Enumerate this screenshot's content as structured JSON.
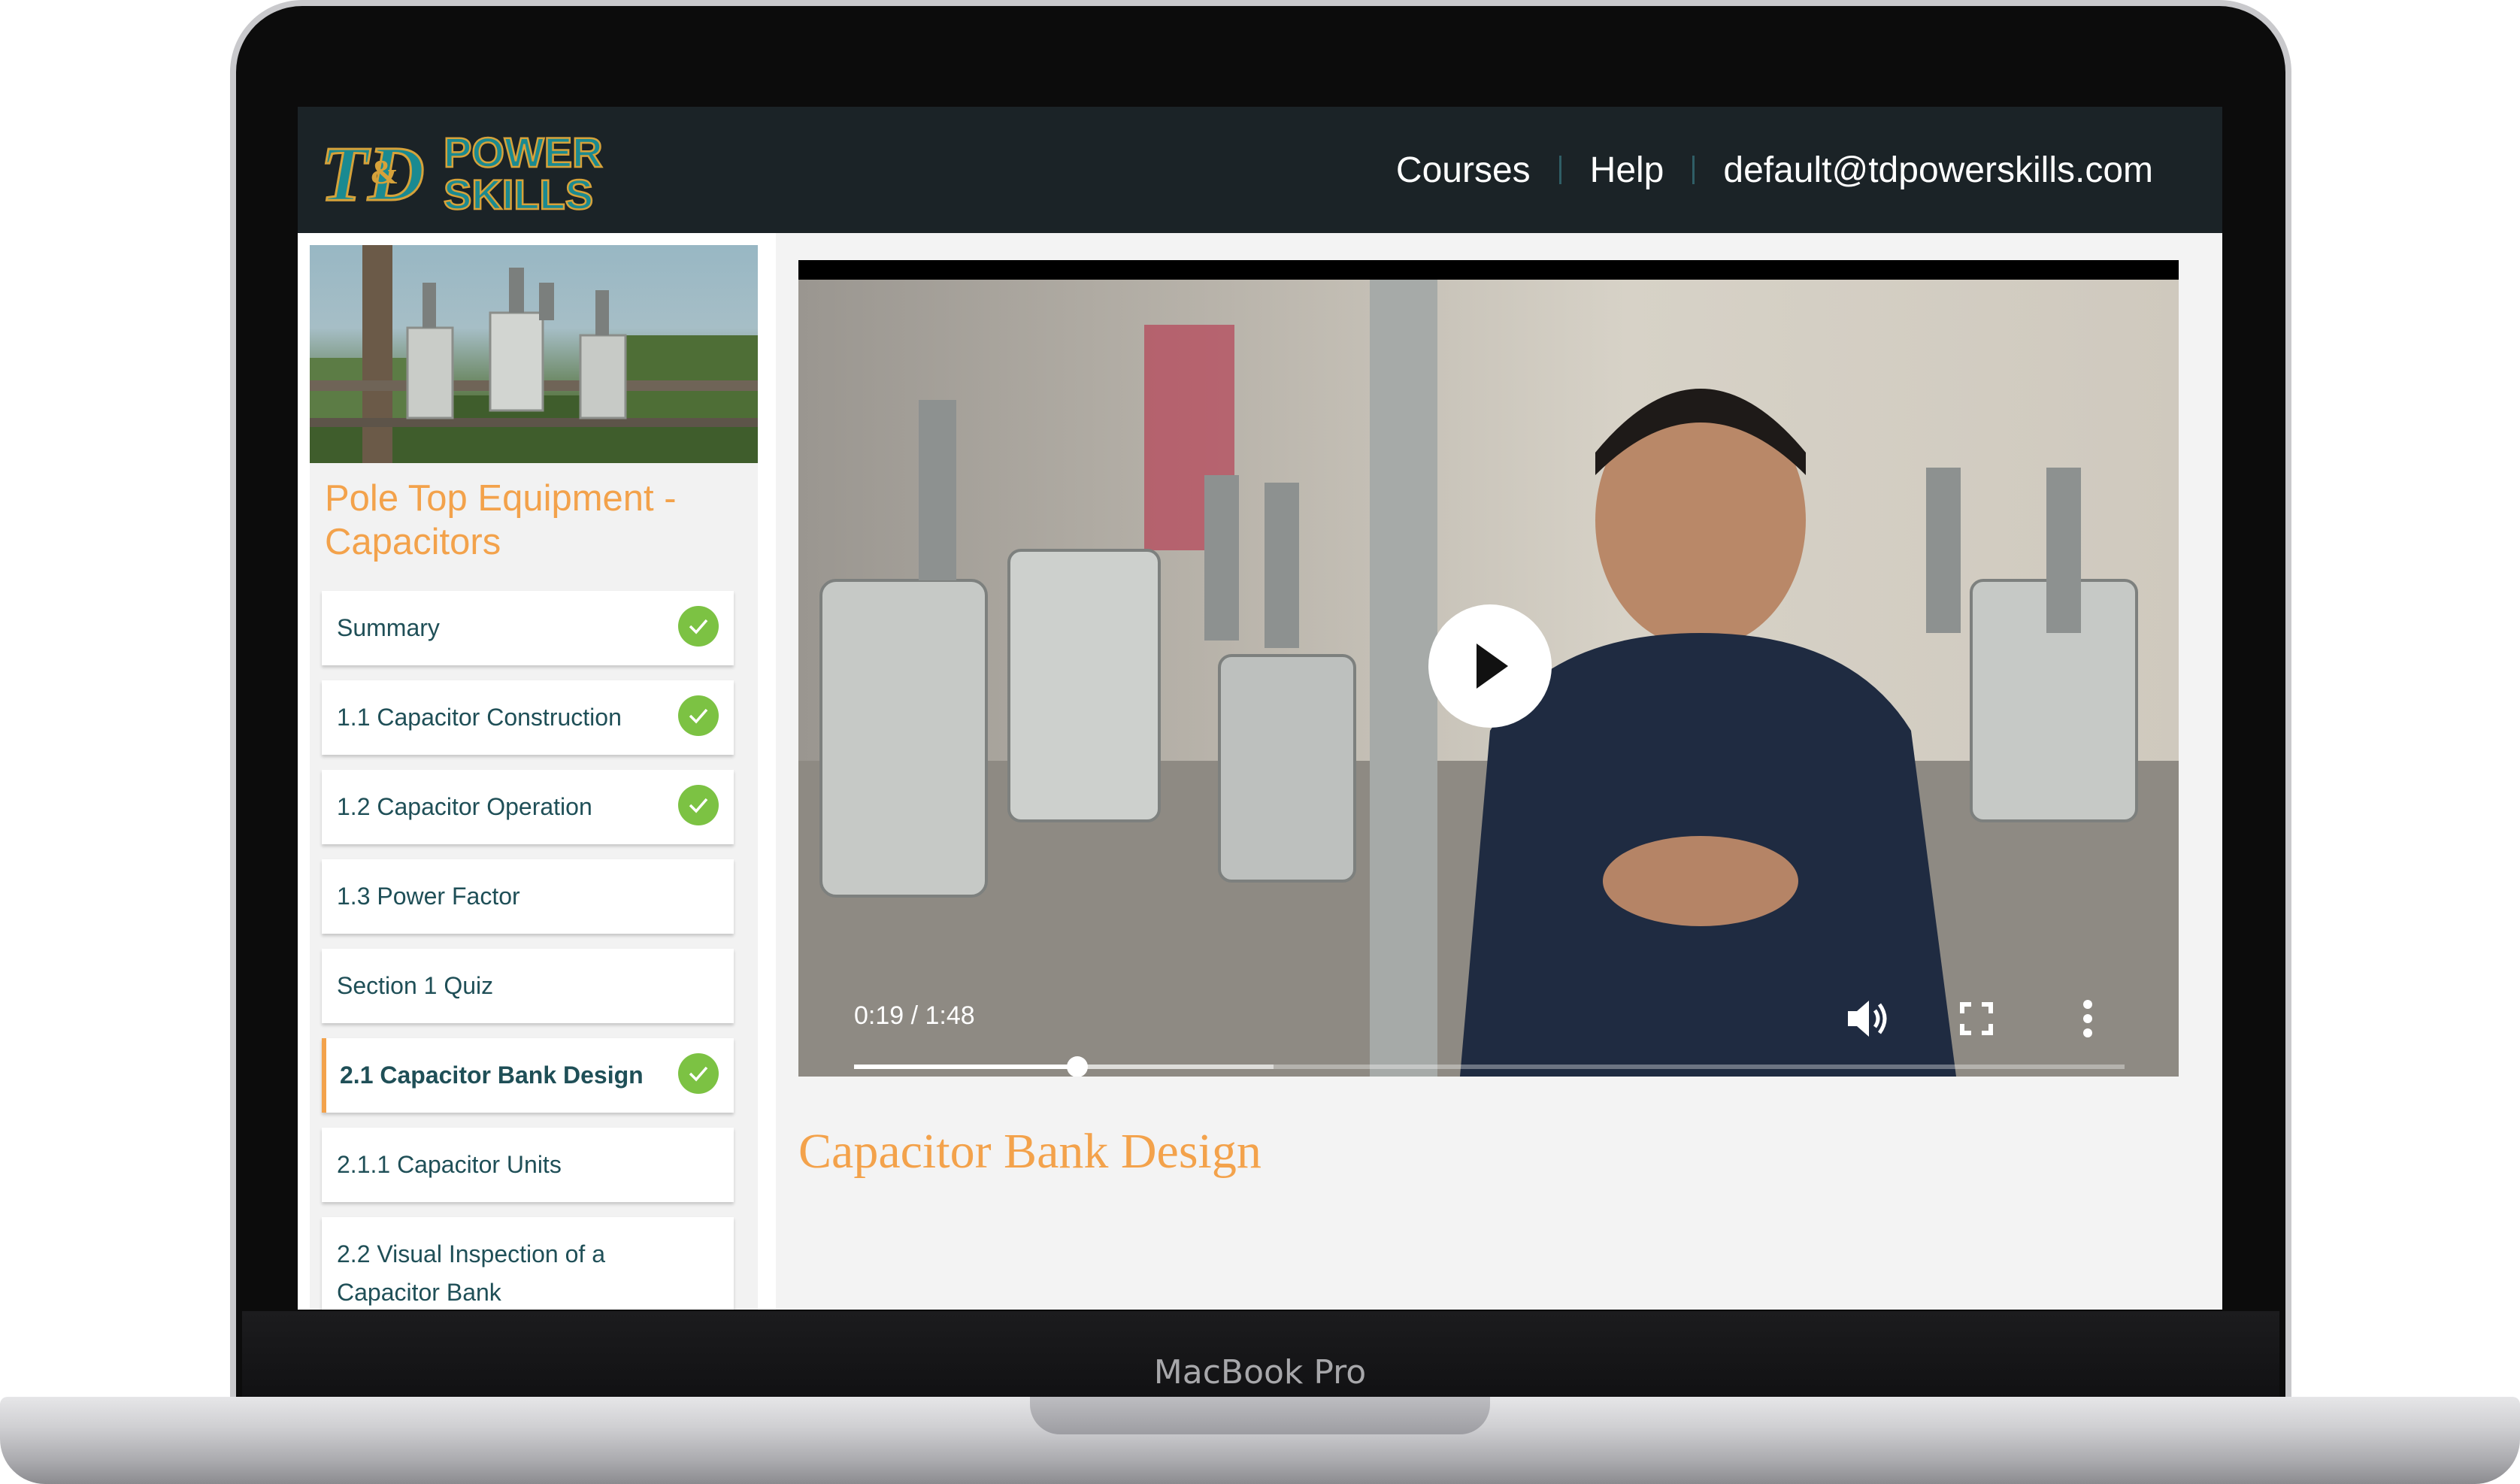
{
  "device": {
    "label": "MacBook Pro"
  },
  "header": {
    "logo_text_line1": "POWER",
    "logo_text_line2": "SKILLS",
    "nav": [
      "Courses",
      "Help",
      "default@tdpowerskills.com"
    ]
  },
  "course": {
    "title": "Pole Top Equipment - Capacitors",
    "lessons": [
      {
        "label": "Summary",
        "completed": true,
        "active": false
      },
      {
        "label": "1.1 Capacitor Construction",
        "completed": true,
        "active": false
      },
      {
        "label": "1.2 Capacitor Operation",
        "completed": true,
        "active": false
      },
      {
        "label": "1.3 Power Factor",
        "completed": false,
        "active": false
      },
      {
        "label": "Section 1 Quiz",
        "completed": false,
        "active": false
      },
      {
        "label": "2.1 Capacitor Bank Design",
        "completed": true,
        "active": true
      },
      {
        "label": "2.1.1 Capacitor Units",
        "completed": false,
        "active": false
      },
      {
        "label": "2.2 Visual Inspection of a Capacitor Bank",
        "completed": false,
        "active": false
      }
    ]
  },
  "video": {
    "time": "0:19 / 1:48",
    "played_fraction": 0.176,
    "buffered_fraction": 0.33
  },
  "main": {
    "title": "Capacitor Bank Design"
  },
  "colors": {
    "accent": "#f3a24b",
    "header_bg": "#1b2327",
    "lesson_text": "#1f4f57",
    "check": "#7cc243"
  }
}
